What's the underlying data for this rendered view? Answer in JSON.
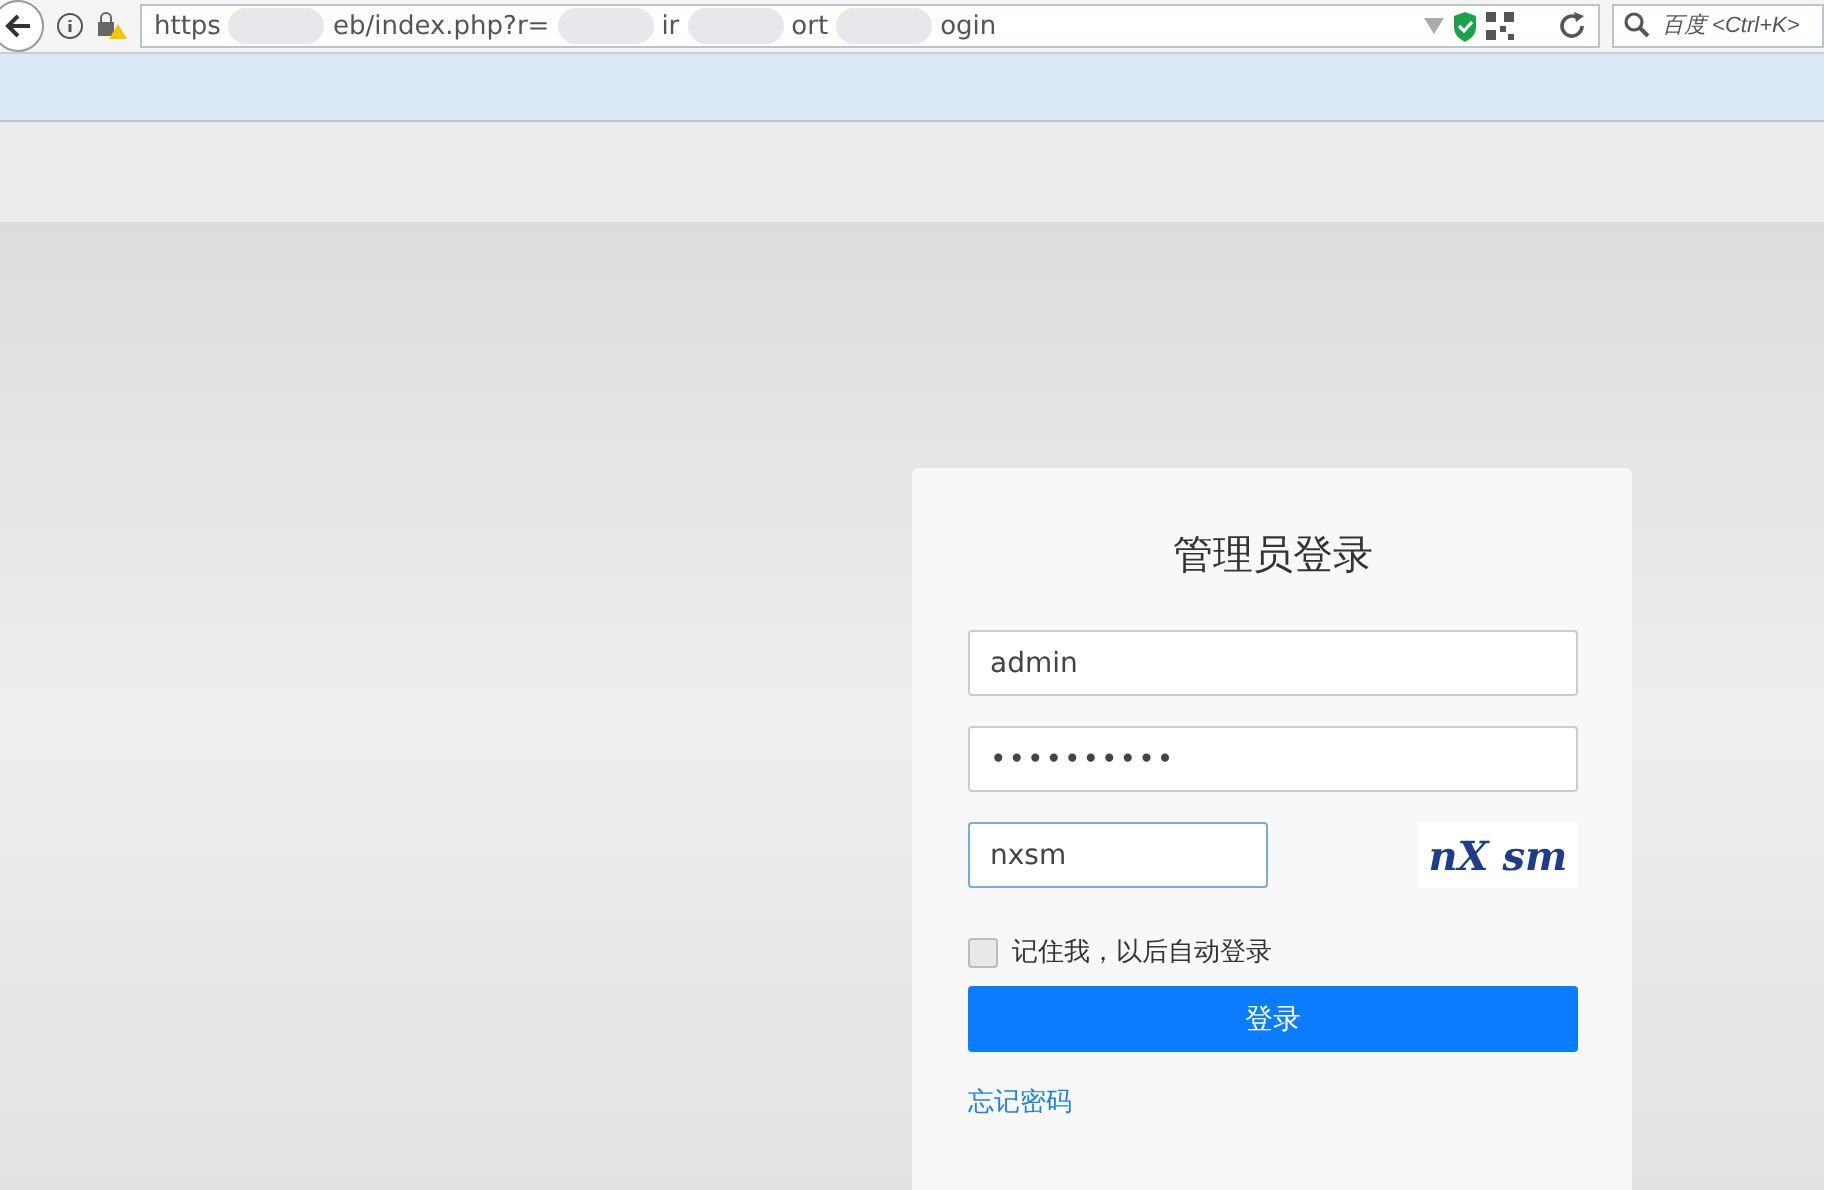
{
  "browser": {
    "url_fragments": [
      "https",
      "eb/index.php?r=",
      "ir",
      "ort",
      "ogin"
    ],
    "search": {
      "placeholder": "百度 <Ctrl+K>"
    }
  },
  "login": {
    "title": "管理员登录",
    "username": {
      "value": "admin"
    },
    "password": {
      "value": "••••••••••"
    },
    "captcha": {
      "value": "nxsm",
      "focused": true,
      "image_text": "nX sm"
    },
    "remember": {
      "label": "记住我，以后自动登录",
      "checked": false
    },
    "submit": "登录",
    "forgot": "忘记密码"
  }
}
